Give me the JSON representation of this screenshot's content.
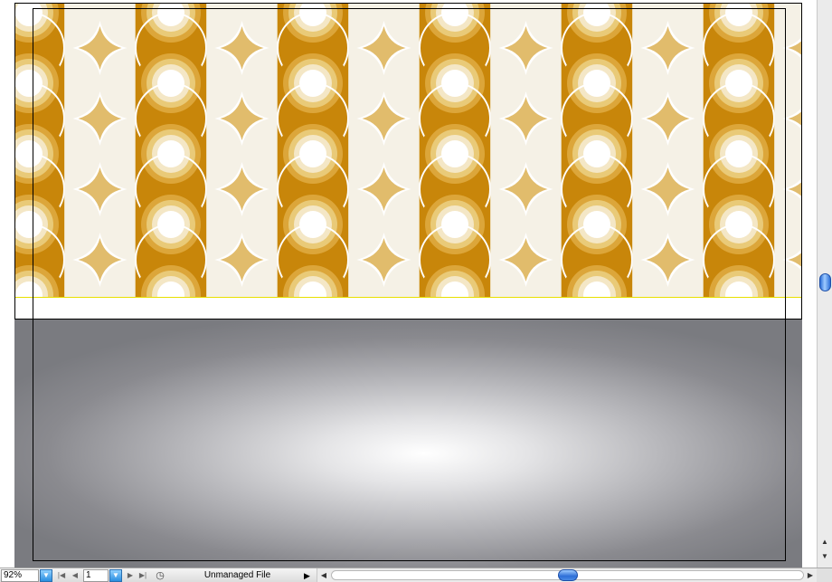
{
  "document": {
    "pattern_colors": {
      "dark": "#c8860a",
      "mid": "#dca63a",
      "light": "#e9ca78",
      "pale": "#f4e7c6",
      "white": "#ffffff",
      "cream": "#f5f1e6",
      "gold": "#e1bc6c"
    },
    "selection_color": "#e8e000",
    "gradient": {
      "center": "#ffffff",
      "edge": "#7a7b80"
    }
  },
  "statusbar": {
    "zoom_value": "92%",
    "page_value": "1",
    "status_text": "Unmanaged File"
  },
  "icons": {
    "zoom_dropdown": "chevron-down-icon",
    "first_page": "first-page-icon",
    "prev_page": "prev-page-icon",
    "page_dropdown": "chevron-down-icon",
    "next_page": "next-page-icon",
    "last_page": "last-page-icon",
    "status_menu": "play-arrow-icon",
    "scroll_left": "arrow-left-icon",
    "scroll_right": "arrow-right-icon"
  }
}
